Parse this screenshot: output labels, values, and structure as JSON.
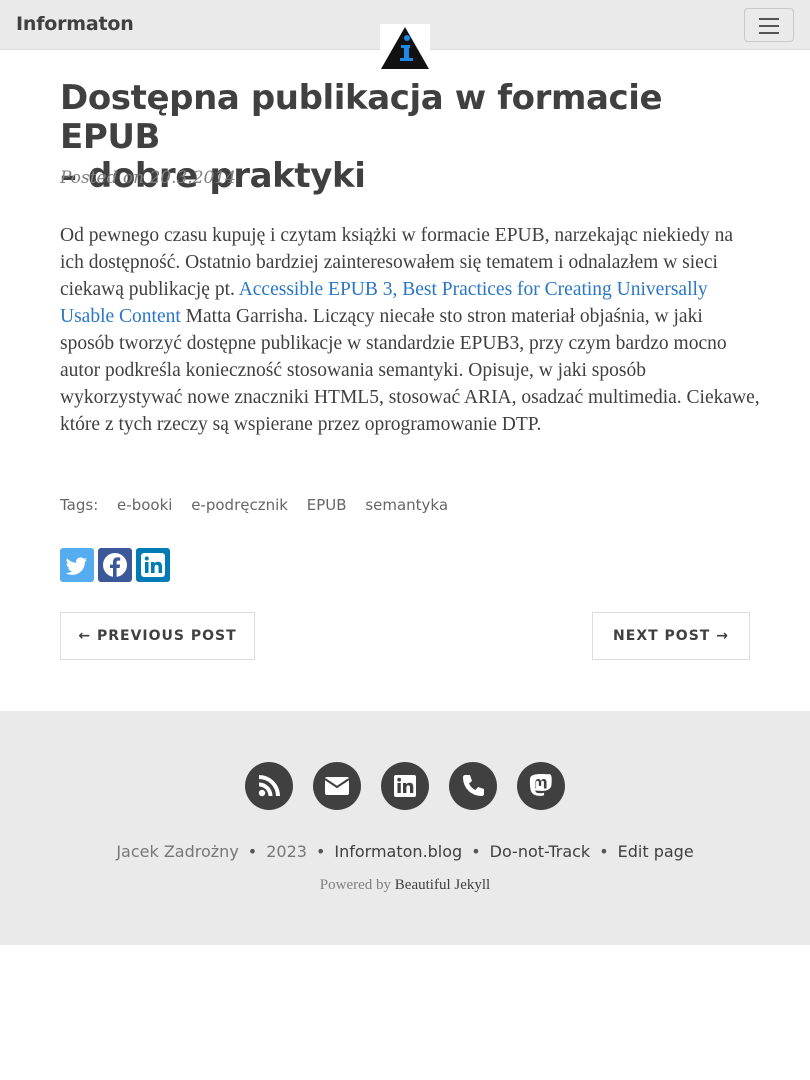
{
  "navbar": {
    "brand": "Informaton",
    "menu_icon": "hamburger-menu-icon",
    "logo_icon": "info-logo-icon"
  },
  "post": {
    "title_line1": "Dostępna publikacja w formacie EPUB",
    "title_line2": "– dobre praktyki",
    "meta": "Posted on 20.3.2014",
    "body_before_link": "Od pewnego czasu kupuję i czytam książki w formacie EPUB, narzekając niekiedy na ich dostępność. Ostatnio bardziej zainteresowałem się tematem i odnalazłem w sieci ciekawą publikację pt. ",
    "body_link": "Accessible EPUB 3, Best Practices for Creating Universally Usable Content",
    "body_after_link": " Matta Garrisha. Liczący niecałe sto stron materiał objaśnia, w jaki sposób tworzyć dostępne publikacje w standardzie EPUB3, przy czym bardzo mocno autor podkreśla konieczność stosowania semantyki. Opisuje, w jaki sposób wykorzystywać nowe znaczniki HTML5, stosować ARIA, osadzać multimedia. Ciekawe, które z tych rzeczy są wspierane przez oprogramowanie DTP.",
    "link_color": "#2a76c6"
  },
  "tags": {
    "label": "Tags:",
    "items": [
      "e-booki",
      "e-podręcznik",
      "EPUB",
      "semantyka"
    ]
  },
  "share": {
    "twitter_icon": "twitter-icon",
    "facebook_icon": "facebook-icon",
    "linkedin_icon": "linkedin-icon",
    "twitter_color": "#55acee",
    "facebook_color": "#3b5998",
    "linkedin_color": "#007bb5"
  },
  "pager": {
    "previous": "← PREVIOUS POST",
    "next": "NEXT POST →"
  },
  "footer": {
    "social_icons": [
      "rss-icon",
      "envelope-icon",
      "linkedin-icon",
      "phone-icon",
      "mastodon-icon"
    ],
    "author": "Jacek Zadrożny",
    "year": "2023",
    "site": "Informaton.blog",
    "dnt": "Do-not-Track",
    "edit": "Edit page",
    "powered_prefix": "Powered by",
    "powered_link": "Beautiful Jekyll",
    "separator": "•"
  }
}
